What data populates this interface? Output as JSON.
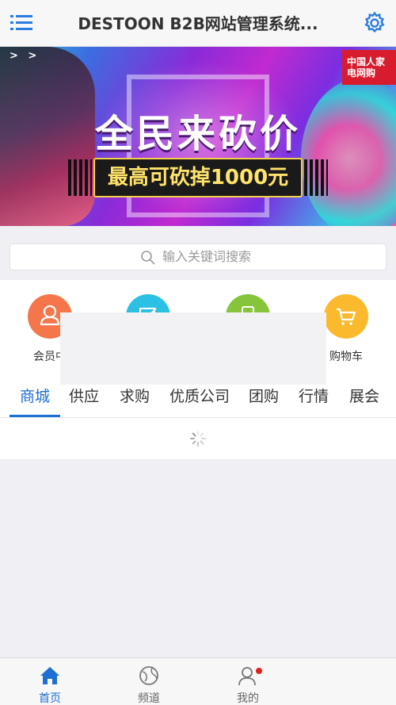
{
  "header": {
    "title": "DESTOON B2B网站管理系统...",
    "menu_icon": "menu-icon",
    "settings_icon": "gear-icon"
  },
  "banner": {
    "headline": "全民来砍价",
    "subline": "最高可砍掉1000元",
    "badge": "中国人家电网购",
    "arrows": "> >",
    "slides_total": 2,
    "active_slide": 1
  },
  "search": {
    "placeholder": "输入关键词搜索"
  },
  "quick_links": [
    {
      "label": "会员中",
      "icon": "user-icon",
      "color": "#f6764b"
    },
    {
      "label": "",
      "icon": "edit-icon",
      "color": "#2bc0e4"
    },
    {
      "label": "",
      "icon": "publish-icon",
      "color": "#86c43a"
    },
    {
      "label": "购物车",
      "icon": "cart-icon",
      "color": "#fbb92e"
    }
  ],
  "tabs": [
    "商城",
    "供应",
    "求购",
    "优质公司",
    "团购",
    "行情",
    "展会"
  ],
  "active_tab": "商城",
  "bottom_nav": [
    {
      "label": "首页",
      "icon": "home-icon",
      "active": true
    },
    {
      "label": "频道",
      "icon": "globe-icon",
      "active": false
    },
    {
      "label": "我的",
      "icon": "user-icon",
      "active": false,
      "badge": true
    }
  ],
  "colors": {
    "accent": "#1d6fd1",
    "badge_red": "#e5201b"
  }
}
